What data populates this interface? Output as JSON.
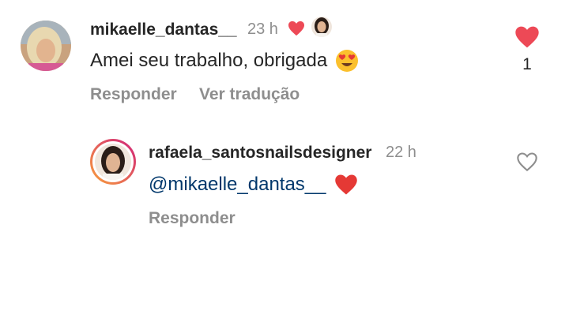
{
  "comment": {
    "username": "mikaelle_dantas__",
    "time": "23 h",
    "text": "Amei seu trabalho, obrigada",
    "reply_label": "Responder",
    "translate_label": "Ver tradução",
    "like_count": "1",
    "liked": true,
    "liked_by_author_icon": "red-heart-icon",
    "text_emoji": "heart-eyes-emoji"
  },
  "reply": {
    "username": "rafaela_santosnailsdesigner",
    "time": "22 h",
    "mention": "@mikaelle_dantas__",
    "text_emoji": "red-heart-emoji",
    "reply_label": "Responder",
    "liked": false,
    "has_story_ring": true
  },
  "colors": {
    "heart_red": "#ed4956",
    "secondary_text": "#8e8e8e",
    "mention_link": "#00376b",
    "story_ring_start": "#f9a13a",
    "story_ring_end": "#d0217b"
  }
}
